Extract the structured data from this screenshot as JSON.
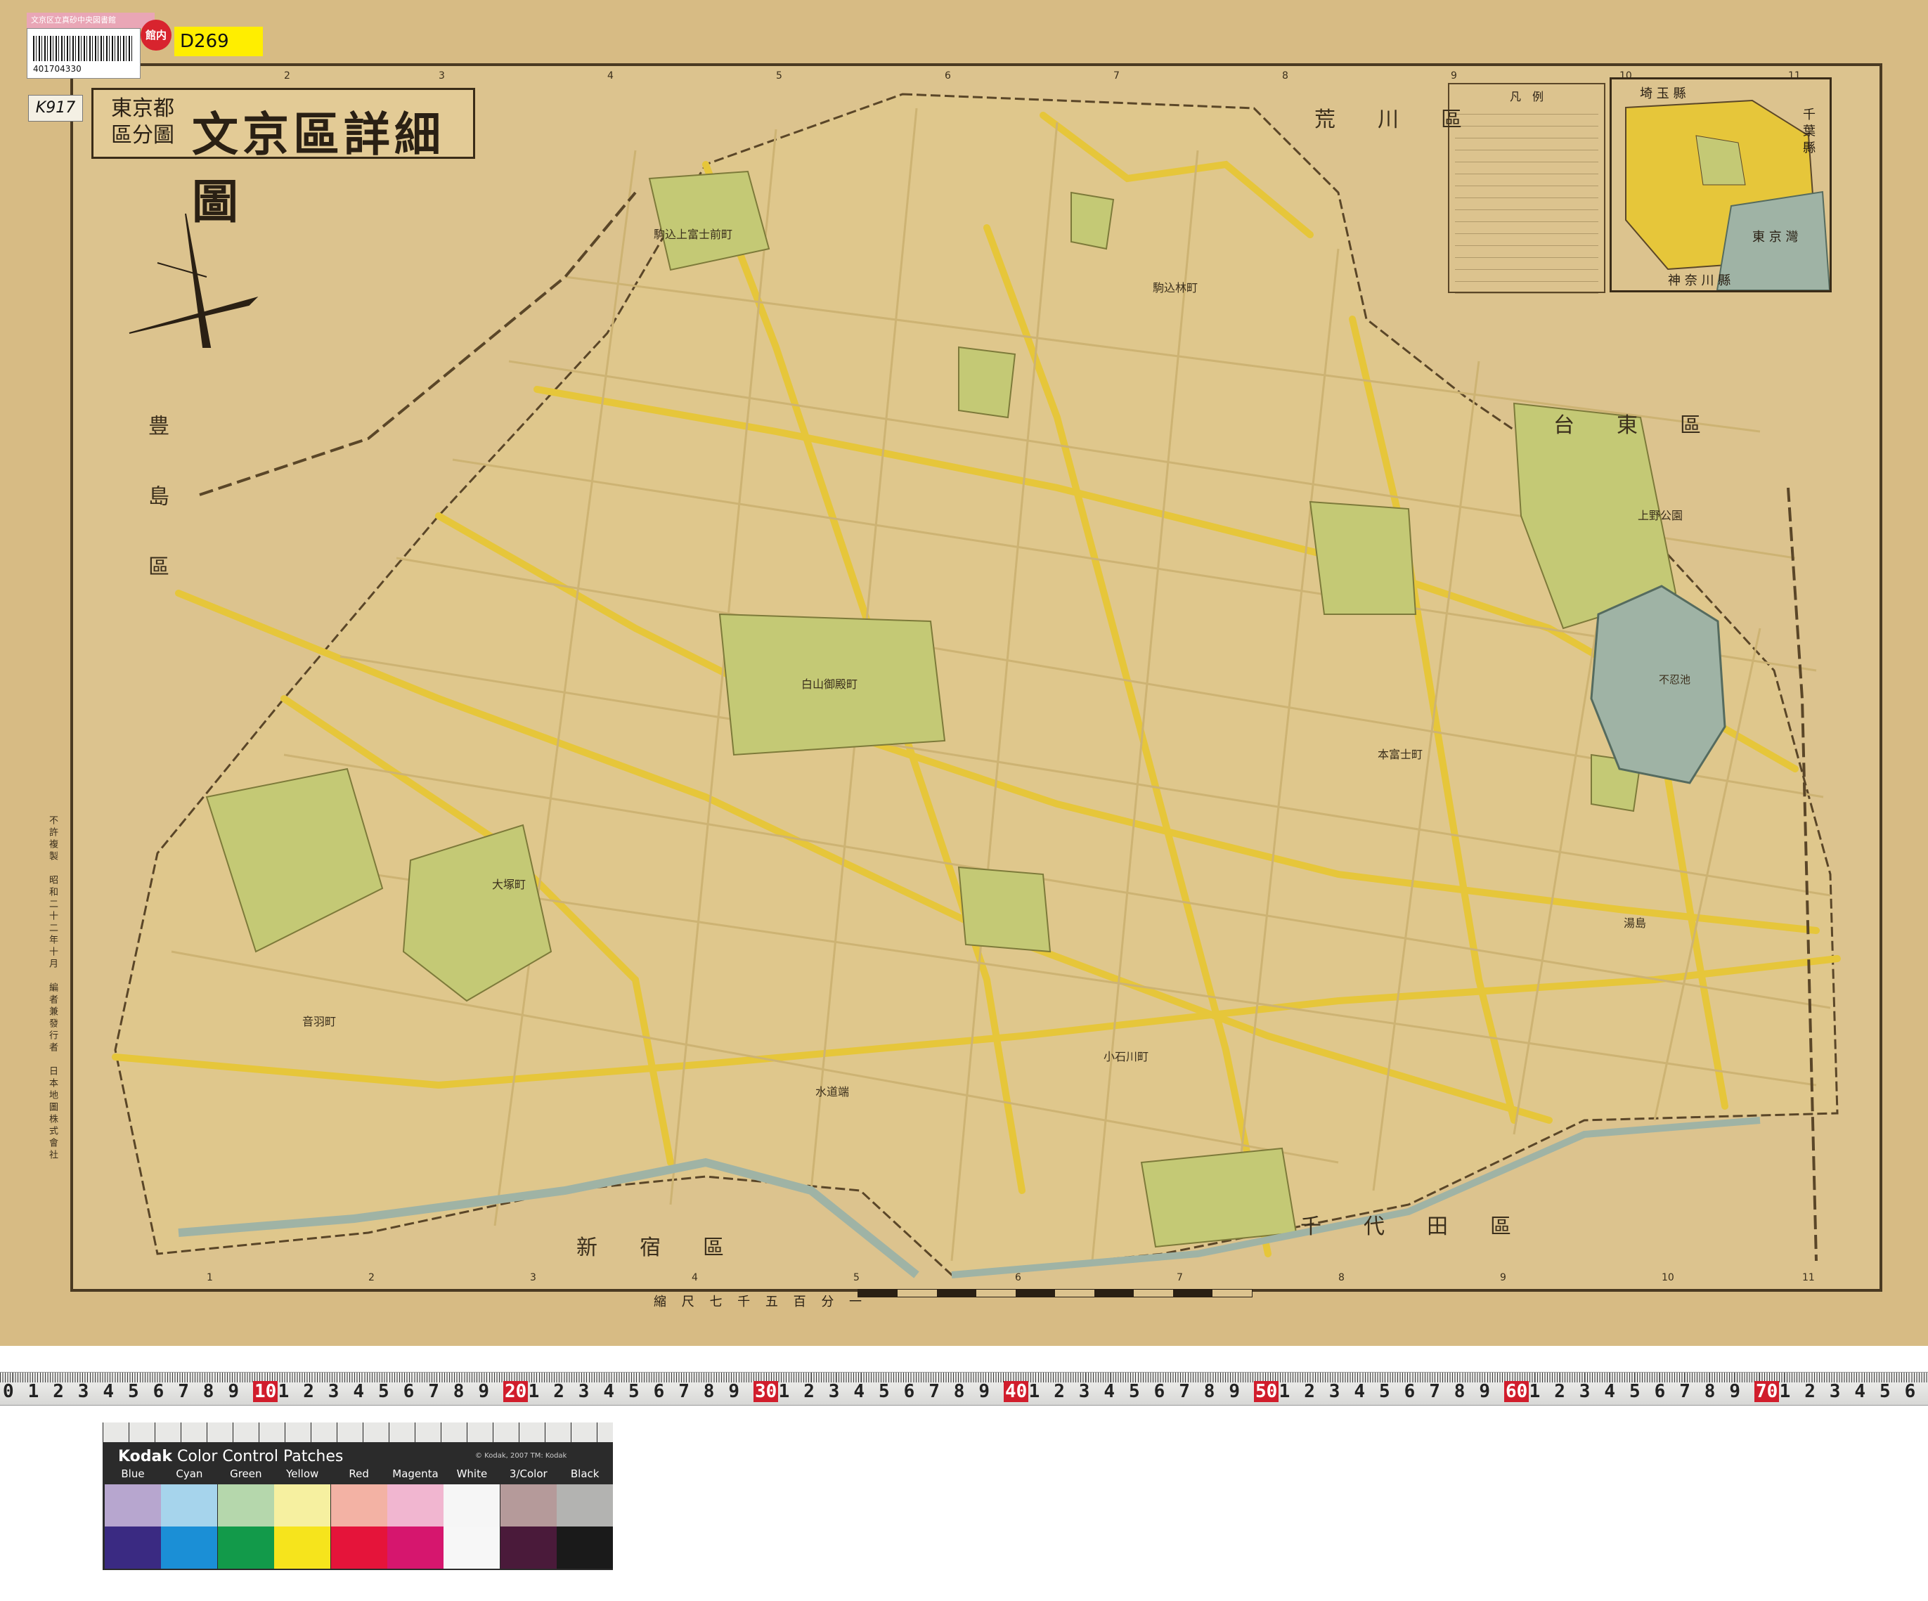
{
  "library": {
    "pink_tag": "文京区立真砂中央図書館",
    "barcode_number": "401704330",
    "badge": "館内",
    "call_number": "D269",
    "shelf_label": "K917"
  },
  "title": {
    "sub_line1": "東京都",
    "sub_line2": "區分圖",
    "main": "文京區詳細圖"
  },
  "legend": {
    "title": "凡　例",
    "row_count_hint": "16"
  },
  "inset": {
    "labels": [
      "埼 玉 縣",
      "千 葉 縣",
      "東 京 灣",
      "神 奈 川 縣"
    ]
  },
  "wards": {
    "arakawa": "荒川區",
    "taito": "台東區",
    "toshima": "豊島區",
    "shinjuku": "新宿區",
    "chiyoda": "千代田區"
  },
  "places": {
    "ueno_park": "上野公園",
    "shinobazu": "不忍池",
    "komagome_fujimae": "駒込上富士前町",
    "komagome_hayashi": "駒込林町",
    "hakusan_goten": "白山御殿町",
    "otowa": "音羽町",
    "otsuka": "大塚町",
    "koishikawa": "小石川町",
    "hongo": "本富士町",
    "yushima": "湯島",
    "suido": "水道端"
  },
  "grid_numbers_top": [
    "2",
    "3",
    "4",
    "5",
    "6",
    "7",
    "8",
    "9",
    "10",
    "11"
  ],
  "grid_numbers_bottom": [
    "1",
    "2",
    "3",
    "4",
    "5",
    "6",
    "7",
    "8",
    "9",
    "10",
    "11"
  ],
  "scale_text": "縮 尺 七 千 五 百 分 一",
  "imprint": "不許複製　昭和二十二年十月　編者兼發行者　日本地圖株式會社",
  "ruler_digits": [
    "0",
    "1",
    "2",
    "3",
    "4",
    "5",
    "6",
    "7",
    "8",
    "9",
    "10",
    "1",
    "2",
    "3",
    "4",
    "5",
    "6",
    "7",
    "8",
    "9",
    "20",
    "1",
    "2",
    "3",
    "4",
    "5",
    "6",
    "7",
    "8",
    "9",
    "30",
    "1",
    "2",
    "3",
    "4",
    "5",
    "6",
    "7",
    "8",
    "9",
    "40",
    "1",
    "2",
    "3",
    "4",
    "5",
    "6",
    "7",
    "8",
    "9",
    "50",
    "1",
    "2",
    "3",
    "4",
    "5",
    "6",
    "7",
    "8",
    "9",
    "60",
    "1",
    "2",
    "3",
    "4",
    "5",
    "6",
    "7",
    "8",
    "9",
    "70",
    "1",
    "2",
    "3",
    "4",
    "5",
    "6"
  ],
  "kodak": {
    "brand": "Kodak",
    "title": "Color Control Patches",
    "copyright": "© Kodak, 2007  TM: Kodak",
    "patches": [
      {
        "label": "Blue",
        "top": "#b7a6cf",
        "bottom": "#3a2a82"
      },
      {
        "label": "Cyan",
        "top": "#a6d4ec",
        "bottom": "#1b8fd6"
      },
      {
        "label": "Green",
        "top": "#b5d7ac",
        "bottom": "#129a4a"
      },
      {
        "label": "Yellow",
        "top": "#f6f0a0",
        "bottom": "#f6e41c"
      },
      {
        "label": "Red",
        "top": "#f3b2a4",
        "bottom": "#e5143a"
      },
      {
        "label": "Magenta",
        "top": "#f1b6d0",
        "bottom": "#d6166e"
      },
      {
        "label": "White",
        "top": "#f6f6f6",
        "bottom": "#f7f7f7"
      },
      {
        "label": "3/Color",
        "top": "#b59a9a",
        "bottom": "#4a1a3a"
      },
      {
        "label": "Black",
        "top": "#b3b3b1",
        "bottom": "#1a1a1a"
      }
    ]
  },
  "colors": {
    "paper": "#d7bb84",
    "road": "#e6c63a",
    "park": "#c4c975",
    "water": "#9fb3a5",
    "ink": "#2a2014"
  }
}
